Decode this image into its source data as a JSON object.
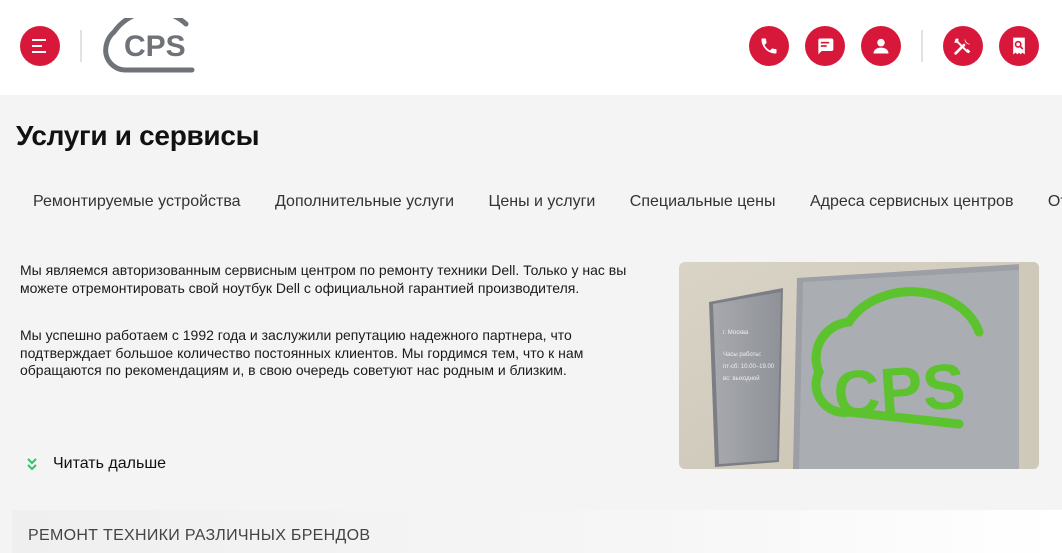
{
  "header": {
    "logo_text": "CPS",
    "icons": {
      "menu": "menu-icon",
      "phone": "phone-icon",
      "chat": "chat-icon",
      "user": "user-icon",
      "tools": "tools-icon",
      "search": "search-icon"
    }
  },
  "page": {
    "title": "Услуги и сервисы"
  },
  "tabs": [
    {
      "label": "Ремонтируемые устройства"
    },
    {
      "label": "Дополнительные услуги"
    },
    {
      "label": "Цены и услуги"
    },
    {
      "label": "Специальные цены"
    },
    {
      "label": "Адреса сервисных центров"
    },
    {
      "label": "Отзывы"
    }
  ],
  "intro": {
    "paragraph1": "Мы являемся авторизованным сервисным центром по ремонту техники Dell. Только у нас вы можете отремонтировать свой ноутбук Dell с официальной гарантией производителя.",
    "paragraph2": "Мы успешно работаем с 1992 года и заслужили репутацию надежного партнера, что подтверждает большое количество постоянных клиентов. Мы гордимся тем, что к нам обращаются по рекомендациям и, в свою очередь советуют нас родным и близким."
  },
  "read_more": {
    "label": "Читать дальше"
  },
  "photo": {
    "sign_logo": "CPS",
    "plaque_lines": [
      "г. Москва",
      "Часы работы:",
      "пт-сб: 10.00–19.00",
      "вс: выходной"
    ]
  },
  "brands_section": {
    "title": "РЕМОНТ ТЕХНИКИ РАЗЛИЧНЫХ БРЕНДОВ"
  },
  "colors": {
    "accent": "#d8183a",
    "logo_gray": "#6f7378",
    "sign_green": "#5cc22e",
    "chevron_green": "#2fc46b"
  }
}
